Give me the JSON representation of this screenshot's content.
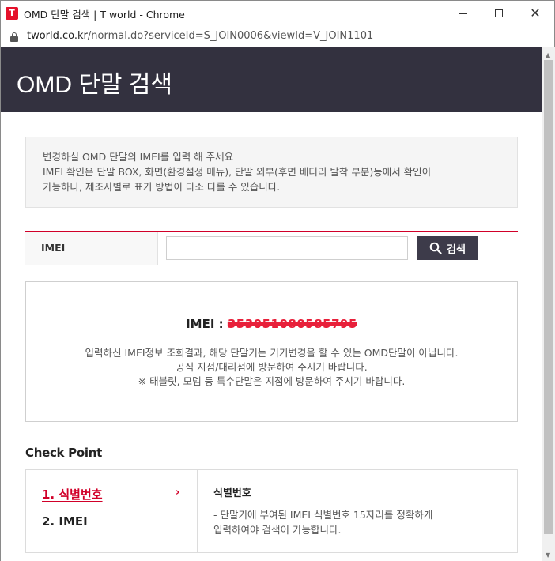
{
  "window": {
    "title": "OMD 단말 검색 | T world - Chrome",
    "logo_text": "T"
  },
  "address": {
    "host": "tworld.co.kr",
    "path": "/normal.do?serviceId=S_JOIN0006&viewId=V_JOIN1101"
  },
  "header": {
    "title": "OMD 단말 검색"
  },
  "notice": {
    "lines": [
      "변경하실 OMD 단말의 IMEI를 입력 해 주세요",
      "IMEI 확인은 단말 BOX, 화면(환경설정 메뉴), 단말 외부(후면 배터리 탈착 부분)등에서 확인이",
      "가능하나, 제조사별로 표기 방법이 다소 다를 수 있습니다."
    ]
  },
  "search": {
    "label": "IMEI",
    "input_value": "",
    "button_label": "검색"
  },
  "result": {
    "imei_prefix": "IMEI : ",
    "imei_value": "353051080585795",
    "messages": [
      "입력하신 IMEI정보 조회결과, 해당 단말기는 기기변경을 할 수 있는 OMD단말이 아닙니다.",
      "공식 지점/대리점에 방문하여 주시기 바랍니다.",
      "※ 태블릿, 모뎀 등 특수단말은 지점에 방문하여 주시기 바랍니다."
    ]
  },
  "checkpoint": {
    "title": "Check Point",
    "tabs": [
      {
        "label": "1. 식별번호"
      },
      {
        "label": "2. IMEI"
      }
    ],
    "detail": {
      "title": "식별번호",
      "lines": [
        "-  단말기에 부여된 IMEI 식별번호 15자리를 정확하게",
        "   입력하여야 검색이 가능합니다."
      ]
    }
  },
  "colors": {
    "header_bg": "#33313f",
    "accent": "#d10029",
    "button_bg": "#3d3b4a"
  }
}
